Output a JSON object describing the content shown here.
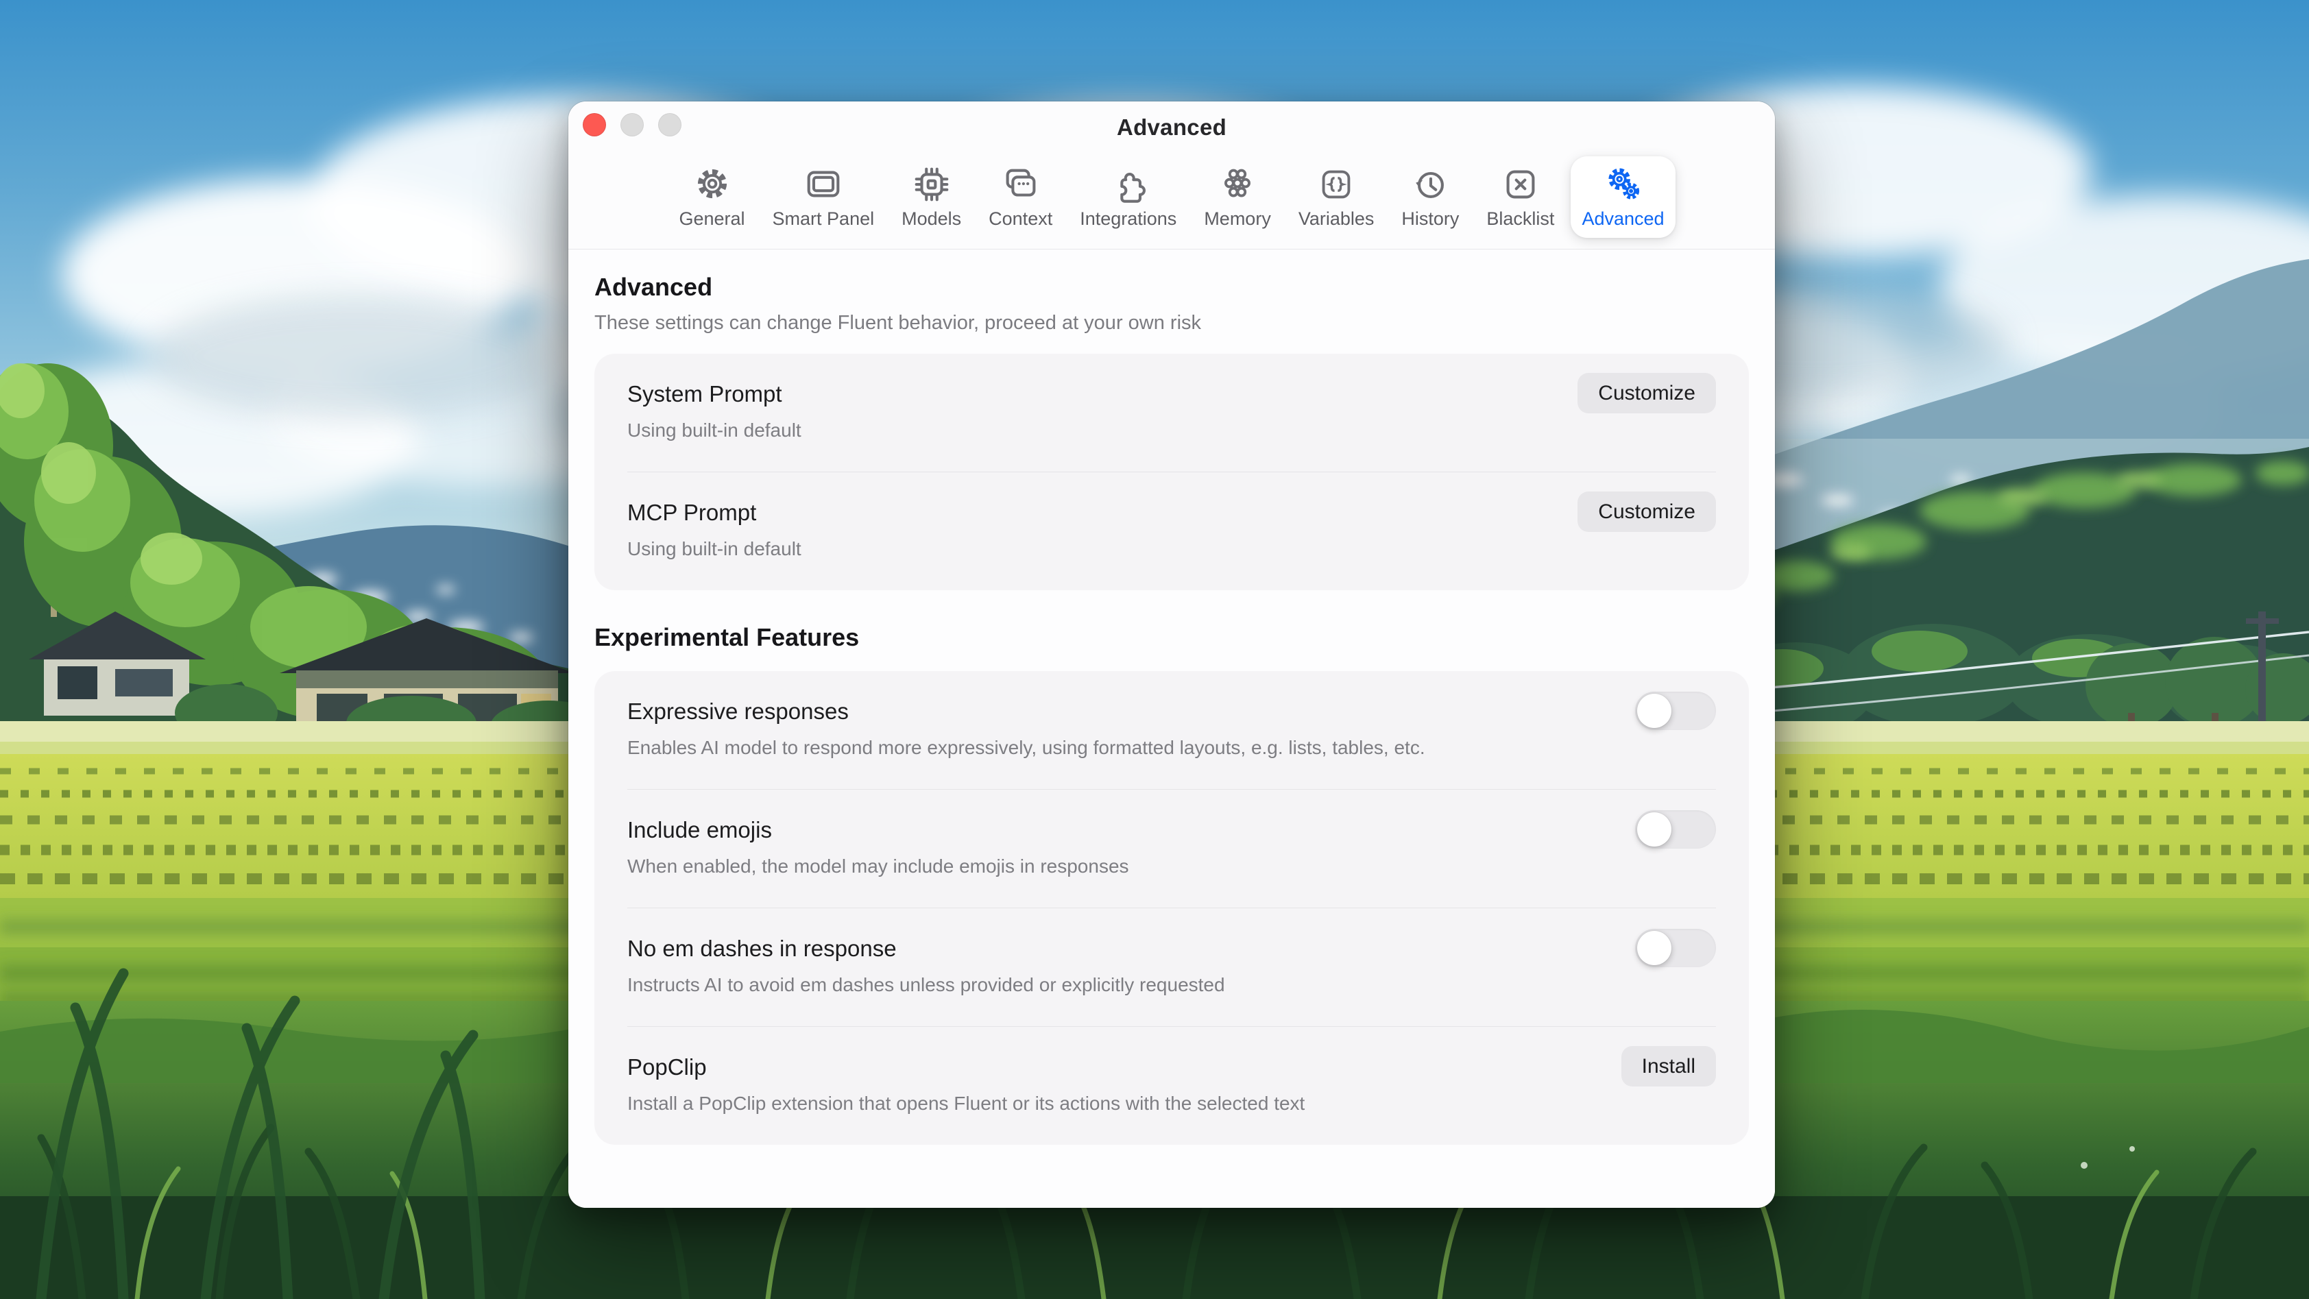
{
  "window": {
    "title": "Advanced",
    "traffic_lights": [
      "close",
      "minimize",
      "zoom"
    ],
    "toolbar": {
      "tabs": [
        {
          "label": "General",
          "icon": "gear-icon",
          "selected": false
        },
        {
          "label": "Smart Panel",
          "icon": "panel-icon",
          "selected": false
        },
        {
          "label": "Models",
          "icon": "chip-icon",
          "selected": false
        },
        {
          "label": "Context",
          "icon": "stacked-windows-icon",
          "selected": false
        },
        {
          "label": "Integrations",
          "icon": "puzzle-icon",
          "selected": false
        },
        {
          "label": "Memory",
          "icon": "molecule-icon",
          "selected": false
        },
        {
          "label": "Variables",
          "icon": "braces-icon",
          "selected": false
        },
        {
          "label": "History",
          "icon": "clock-arrow-icon",
          "selected": false
        },
        {
          "label": "Blacklist",
          "icon": "x-square-icon",
          "selected": false
        },
        {
          "label": "Advanced",
          "icon": "double-gear-icon",
          "selected": true
        }
      ]
    },
    "advanced_section": {
      "heading": "Advanced",
      "subtitle": "These settings can change Fluent behavior, proceed at your own risk",
      "rows": [
        {
          "title": "System Prompt",
          "status": "Using built-in default",
          "action": "Customize"
        },
        {
          "title": "MCP Prompt",
          "status": "Using built-in default",
          "action": "Customize"
        }
      ]
    },
    "experimental_section": {
      "heading": "Experimental Features",
      "rows": [
        {
          "title": "Expressive responses",
          "description": "Enables AI model to respond more expressively, using formatted layouts, e.g. lists, tables, etc.",
          "control": "toggle",
          "state": "off"
        },
        {
          "title": "Include emojis",
          "description": "When enabled, the model may include emojis in responses",
          "control": "toggle",
          "state": "off"
        },
        {
          "title": "No em dashes in response",
          "description": "Instructs AI to avoid em dashes unless provided or explicitly requested",
          "control": "toggle",
          "state": "off"
        },
        {
          "title": "PopClip",
          "description": "Install a PopClip extension that opens Fluent or its actions with the selected text",
          "control": "button",
          "action": "Install"
        }
      ]
    }
  },
  "colors": {
    "accent_blue": "#0e66f3",
    "toolbar_icon_gray": "#6e6e73",
    "content_bg": "#fdfdfe",
    "card_bg": "#f5f4f6",
    "button_bg": "#e7e6e9",
    "toggle_track": "#e8e7ea",
    "traffic_red": "#fd5952",
    "traffic_gray": "#dcdcdc",
    "text_primary": "#1c1c1e",
    "text_secondary": "#7d7d82"
  }
}
